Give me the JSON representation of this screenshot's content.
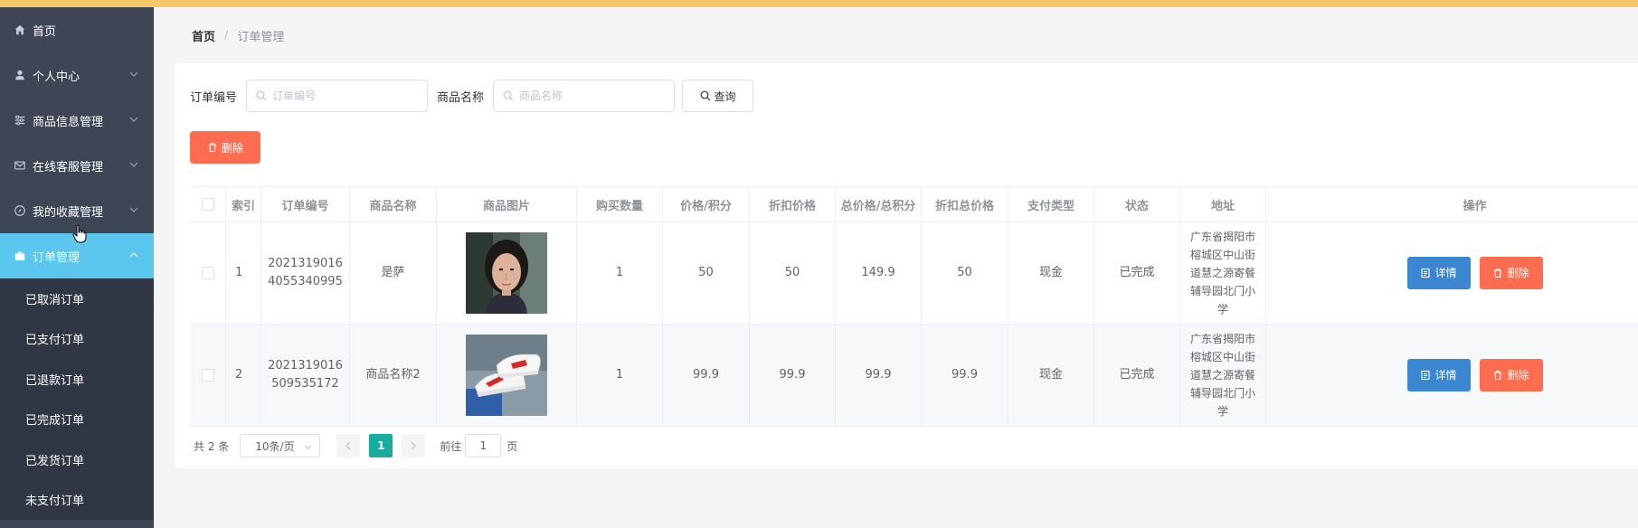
{
  "sidebar": {
    "items": [
      {
        "label": "首页",
        "icon": "home-icon",
        "has_chevron": false
      },
      {
        "label": "个人中心",
        "icon": "user-icon",
        "has_chevron": true
      },
      {
        "label": "商品信息管理",
        "icon": "sliders-icon",
        "has_chevron": true
      },
      {
        "label": "在线客服管理",
        "icon": "mail-icon",
        "has_chevron": true
      },
      {
        "label": "我的收藏管理",
        "icon": "compass-icon",
        "has_chevron": true
      },
      {
        "label": "订单管理",
        "icon": "briefcase-icon",
        "has_chevron": true,
        "active": true
      }
    ],
    "subitems": [
      "已取消订单",
      "已支付订单",
      "已退款订单",
      "已完成订单",
      "已发货订单",
      "未支付订单"
    ],
    "colors": {
      "background": "#3e4656",
      "active": "#5bc6ee",
      "submenu": "#303744"
    }
  },
  "breadcrumb": {
    "home": "首页",
    "separator": "/",
    "current": "订单管理"
  },
  "search": {
    "order_no_label": "订单编号",
    "order_no_placeholder": "订单编号",
    "product_label": "商品名称",
    "product_placeholder": "商品名称",
    "query_label": "查询"
  },
  "toolbar": {
    "delete_label": "删除"
  },
  "table": {
    "headers": [
      "索引",
      "订单编号",
      "商品名称",
      "商品图片",
      "购买数量",
      "价格/积分",
      "折扣价格",
      "总价格/总积分",
      "折扣总价格",
      "支付类型",
      "状态",
      "地址",
      "操作"
    ],
    "rows": [
      {
        "index": "1",
        "order_no": "20213190164055340995",
        "product_name": "是萨",
        "image": "portrait-photo",
        "quantity": "1",
        "price": "50",
        "discount_price": "50",
        "total_price": "149.9",
        "discount_total": "50",
        "pay_type": "现金",
        "status": "已完成",
        "address": "广东省揭阳市榕城区中山街道慧之源寄餐辅导园北门小学"
      },
      {
        "index": "2",
        "order_no": "2021319016509535172",
        "product_name": "商品名称2",
        "image": "sneakers-photo",
        "quantity": "1",
        "price": "99.9",
        "discount_price": "99.9",
        "total_price": "99.9",
        "discount_total": "99.9",
        "pay_type": "现金",
        "status": "已完成",
        "address": "广东省揭阳市榕城区中山街道慧之源寄餐辅导园北门小学"
      }
    ],
    "row_actions": {
      "detail_label": "详情",
      "delete_label": "删除"
    }
  },
  "pagination": {
    "total_text": "共 2 条",
    "page_size": "10条/页",
    "current_page": "1",
    "goto_label": "前往",
    "goto_value": "1",
    "page_unit": "页"
  },
  "colors": {
    "top_accent": "#f5c86a",
    "primary_blue": "#3b86d1",
    "danger": "#fe6d4f",
    "page_active": "#14ad9e"
  }
}
